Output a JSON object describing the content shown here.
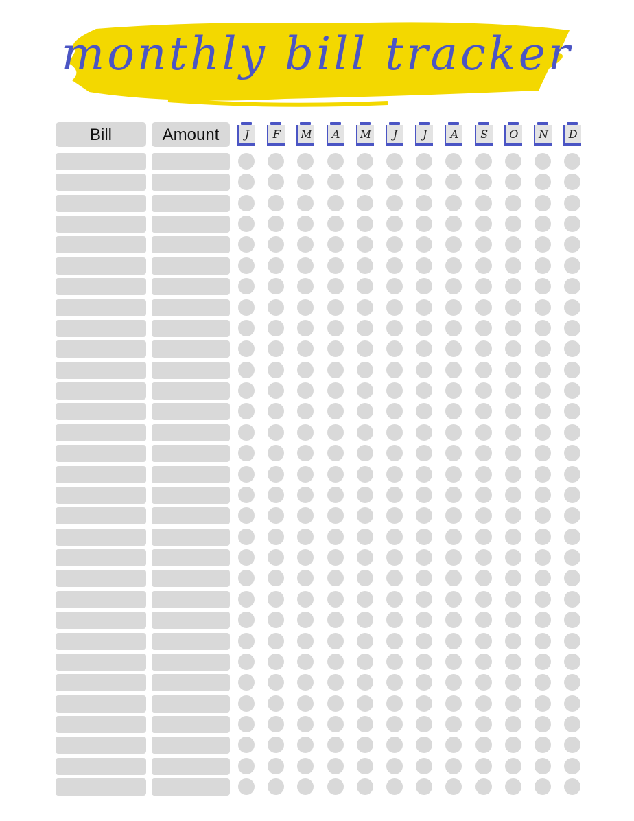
{
  "title": "monthly bill tracker",
  "colors": {
    "accent": "#4b55c4",
    "highlight": "#f3d800",
    "cell": "#d9d9d9"
  },
  "header": {
    "bill": "Bill",
    "amount": "Amount"
  },
  "months": [
    "J",
    "F",
    "M",
    "A",
    "M",
    "J",
    "J",
    "A",
    "S",
    "O",
    "N",
    "D"
  ]
}
